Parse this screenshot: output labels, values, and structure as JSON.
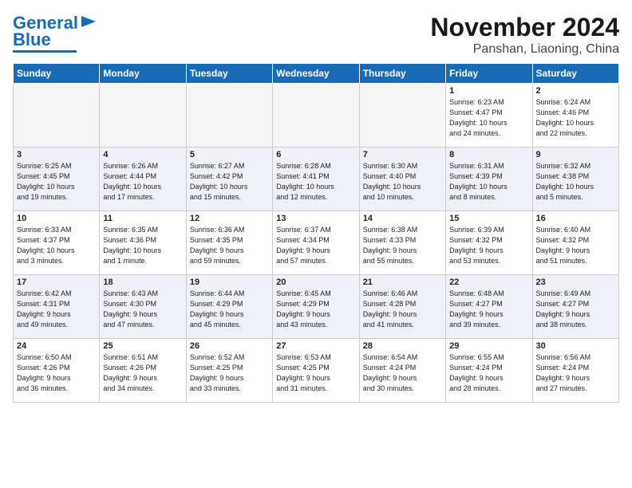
{
  "header": {
    "logo_line1": "General",
    "logo_line2": "Blue",
    "title": "November 2024",
    "subtitle": "Panshan, Liaoning, China"
  },
  "weekdays": [
    "Sunday",
    "Monday",
    "Tuesday",
    "Wednesday",
    "Thursday",
    "Friday",
    "Saturday"
  ],
  "weeks": [
    [
      {
        "day": "",
        "info": ""
      },
      {
        "day": "",
        "info": ""
      },
      {
        "day": "",
        "info": ""
      },
      {
        "day": "",
        "info": ""
      },
      {
        "day": "",
        "info": ""
      },
      {
        "day": "1",
        "info": "Sunrise: 6:23 AM\nSunset: 4:47 PM\nDaylight: 10 hours\nand 24 minutes."
      },
      {
        "day": "2",
        "info": "Sunrise: 6:24 AM\nSunset: 4:46 PM\nDaylight: 10 hours\nand 22 minutes."
      }
    ],
    [
      {
        "day": "3",
        "info": "Sunrise: 6:25 AM\nSunset: 4:45 PM\nDaylight: 10 hours\nand 19 minutes."
      },
      {
        "day": "4",
        "info": "Sunrise: 6:26 AM\nSunset: 4:44 PM\nDaylight: 10 hours\nand 17 minutes."
      },
      {
        "day": "5",
        "info": "Sunrise: 6:27 AM\nSunset: 4:42 PM\nDaylight: 10 hours\nand 15 minutes."
      },
      {
        "day": "6",
        "info": "Sunrise: 6:28 AM\nSunset: 4:41 PM\nDaylight: 10 hours\nand 12 minutes."
      },
      {
        "day": "7",
        "info": "Sunrise: 6:30 AM\nSunset: 4:40 PM\nDaylight: 10 hours\nand 10 minutes."
      },
      {
        "day": "8",
        "info": "Sunrise: 6:31 AM\nSunset: 4:39 PM\nDaylight: 10 hours\nand 8 minutes."
      },
      {
        "day": "9",
        "info": "Sunrise: 6:32 AM\nSunset: 4:38 PM\nDaylight: 10 hours\nand 5 minutes."
      }
    ],
    [
      {
        "day": "10",
        "info": "Sunrise: 6:33 AM\nSunset: 4:37 PM\nDaylight: 10 hours\nand 3 minutes."
      },
      {
        "day": "11",
        "info": "Sunrise: 6:35 AM\nSunset: 4:36 PM\nDaylight: 10 hours\nand 1 minute."
      },
      {
        "day": "12",
        "info": "Sunrise: 6:36 AM\nSunset: 4:35 PM\nDaylight: 9 hours\nand 59 minutes."
      },
      {
        "day": "13",
        "info": "Sunrise: 6:37 AM\nSunset: 4:34 PM\nDaylight: 9 hours\nand 57 minutes."
      },
      {
        "day": "14",
        "info": "Sunrise: 6:38 AM\nSunset: 4:33 PM\nDaylight: 9 hours\nand 55 minutes."
      },
      {
        "day": "15",
        "info": "Sunrise: 6:39 AM\nSunset: 4:32 PM\nDaylight: 9 hours\nand 53 minutes."
      },
      {
        "day": "16",
        "info": "Sunrise: 6:40 AM\nSunset: 4:32 PM\nDaylight: 9 hours\nand 51 minutes."
      }
    ],
    [
      {
        "day": "17",
        "info": "Sunrise: 6:42 AM\nSunset: 4:31 PM\nDaylight: 9 hours\nand 49 minutes."
      },
      {
        "day": "18",
        "info": "Sunrise: 6:43 AM\nSunset: 4:30 PM\nDaylight: 9 hours\nand 47 minutes."
      },
      {
        "day": "19",
        "info": "Sunrise: 6:44 AM\nSunset: 4:29 PM\nDaylight: 9 hours\nand 45 minutes."
      },
      {
        "day": "20",
        "info": "Sunrise: 6:45 AM\nSunset: 4:29 PM\nDaylight: 9 hours\nand 43 minutes."
      },
      {
        "day": "21",
        "info": "Sunrise: 6:46 AM\nSunset: 4:28 PM\nDaylight: 9 hours\nand 41 minutes."
      },
      {
        "day": "22",
        "info": "Sunrise: 6:48 AM\nSunset: 4:27 PM\nDaylight: 9 hours\nand 39 minutes."
      },
      {
        "day": "23",
        "info": "Sunrise: 6:49 AM\nSunset: 4:27 PM\nDaylight: 9 hours\nand 38 minutes."
      }
    ],
    [
      {
        "day": "24",
        "info": "Sunrise: 6:50 AM\nSunset: 4:26 PM\nDaylight: 9 hours\nand 36 minutes."
      },
      {
        "day": "25",
        "info": "Sunrise: 6:51 AM\nSunset: 4:26 PM\nDaylight: 9 hours\nand 34 minutes."
      },
      {
        "day": "26",
        "info": "Sunrise: 6:52 AM\nSunset: 4:25 PM\nDaylight: 9 hours\nand 33 minutes."
      },
      {
        "day": "27",
        "info": "Sunrise: 6:53 AM\nSunset: 4:25 PM\nDaylight: 9 hours\nand 31 minutes."
      },
      {
        "day": "28",
        "info": "Sunrise: 6:54 AM\nSunset: 4:24 PM\nDaylight: 9 hours\nand 30 minutes."
      },
      {
        "day": "29",
        "info": "Sunrise: 6:55 AM\nSunset: 4:24 PM\nDaylight: 9 hours\nand 28 minutes."
      },
      {
        "day": "30",
        "info": "Sunrise: 6:56 AM\nSunset: 4:24 PM\nDaylight: 9 hours\nand 27 minutes."
      }
    ]
  ]
}
